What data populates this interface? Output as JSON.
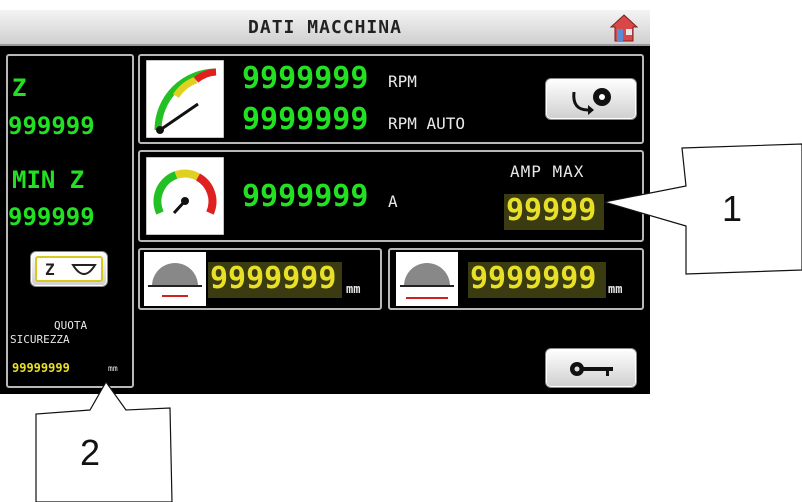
{
  "window": {
    "title": "DATI MACCHINA",
    "home_icon": "home-icon"
  },
  "left": {
    "z_label": "Z",
    "z_value": "999999",
    "minz_label": "MIN Z",
    "minz_value": "999999",
    "z_button_label": "Z",
    "quota_label": "QUOTA",
    "sicurezza_label": "SICUREZZA",
    "safety_value": "99999999",
    "safety_unit": "mm"
  },
  "rpm": {
    "value": "9999999",
    "unit": "RPM",
    "auto_value": "9999999",
    "auto_unit": "RPM AUTO",
    "gauge_icon": "rpm-gauge-icon",
    "button_icon": "rotate-blade-icon"
  },
  "amp": {
    "value": "9999999",
    "unit": "A",
    "max_label": "AMP MAX",
    "max_value": "99999",
    "gauge_icon": "amp-gauge-icon"
  },
  "blade": {
    "left_value": "9999999",
    "left_unit": "mm",
    "right_value": "9999999",
    "right_unit": "mm"
  },
  "key_button_icon": "key-icon",
  "callouts": {
    "one": "1",
    "two": "2"
  },
  "colors": {
    "background": "#000000",
    "value_green": "#22e022",
    "value_yellow": "#e8e026"
  }
}
